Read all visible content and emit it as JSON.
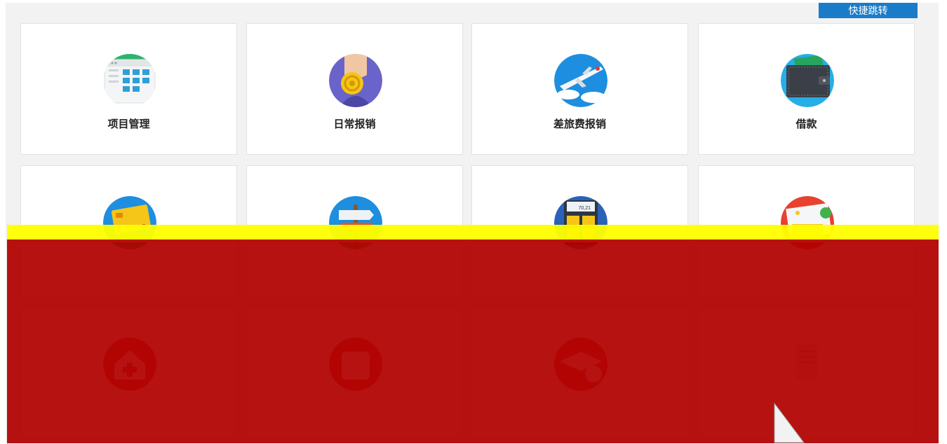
{
  "header": {
    "quick_jump_label": "快捷跳转"
  },
  "tiles": [
    {
      "label": "项目管理",
      "icon": "project-management-icon"
    },
    {
      "label": "日常报销",
      "icon": "coin-hand-icon"
    },
    {
      "label": "差旅费报销",
      "icon": "airplane-icon"
    },
    {
      "label": "借款",
      "icon": "wallet-icon"
    },
    {
      "label": "",
      "icon": "credit-card-icon"
    },
    {
      "label": "",
      "icon": "signpost-icon"
    },
    {
      "label": "",
      "icon": "calculator-icon"
    },
    {
      "label": "",
      "icon": "pen-document-icon"
    },
    {
      "label": "",
      "icon": "house-plus-icon"
    },
    {
      "label": "",
      "icon": "box-icon"
    },
    {
      "label": "",
      "icon": "graduation-cap-icon"
    },
    {
      "label": "",
      "icon": "document-list-icon"
    }
  ],
  "colors": {
    "accent": "#1a7cc9",
    "overlay_red": "#b00000",
    "overlay_yellow": "#ffff00"
  }
}
